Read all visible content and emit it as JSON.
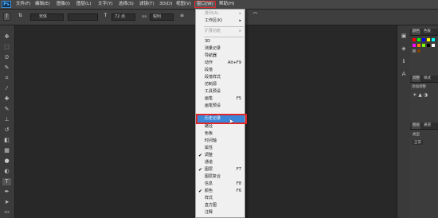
{
  "app": {
    "logo": "Ps"
  },
  "menubar": {
    "items": [
      {
        "label": "文件(F)"
      },
      {
        "label": "编辑(E)"
      },
      {
        "label": "图像(I)"
      },
      {
        "label": "图层(L)"
      },
      {
        "label": "文字(Y)"
      },
      {
        "label": "选择(S)"
      },
      {
        "label": "滤镜(T)"
      },
      {
        "label": "3D(D)"
      },
      {
        "label": "视图(V)"
      },
      {
        "label": "窗口(W)"
      },
      {
        "label": "帮助(H)"
      }
    ]
  },
  "options": {
    "font_family": "宋体",
    "font_size": "72 点",
    "antialias": "锐利"
  },
  "window_menu": {
    "items": [
      {
        "label": "排列(A)",
        "shortcut": "▸",
        "disabled": true
      },
      {
        "label": "工作区(K)",
        "shortcut": "▸"
      },
      {
        "label": "扩展功能",
        "shortcut": "▸",
        "disabled": true
      },
      {
        "label": "3D"
      },
      {
        "label": "测量记录"
      },
      {
        "label": "导航器"
      },
      {
        "label": "动作",
        "shortcut": "Alt+F9"
      },
      {
        "label": "段落"
      },
      {
        "label": "段落样式"
      },
      {
        "label": "仿制源"
      },
      {
        "label": "工具预设"
      },
      {
        "label": "画笔",
        "shortcut": "F5"
      },
      {
        "label": "画笔预设"
      },
      {
        "label": "历史记录",
        "highlighted": true
      },
      {
        "label": "路径"
      },
      {
        "label": "色板"
      },
      {
        "label": "时间轴"
      },
      {
        "label": "属性"
      },
      {
        "label": "调整",
        "checked": true
      },
      {
        "label": "通道"
      },
      {
        "label": "图层",
        "shortcut": "F7",
        "checked": true
      },
      {
        "label": "图层复合"
      },
      {
        "label": "信息",
        "shortcut": "F8"
      },
      {
        "label": "颜色",
        "shortcut": "F6",
        "checked": true
      },
      {
        "label": "样式"
      },
      {
        "label": "直方图"
      },
      {
        "label": "注释"
      }
    ]
  },
  "panels": {
    "color_tab": "颜色",
    "swatches_tab": "色板",
    "adjust_tab": "调整",
    "styles_tab": "样式",
    "add_adjust": "添加调整",
    "layers_tab": "图层",
    "channels_tab": "通道",
    "blend_mode": "正常",
    "kind": "类型"
  },
  "colors": {
    "accent_highlight": "#3a86d8",
    "annotation_red": "#e1262a",
    "swatches": [
      "#ff0000",
      "#00ff00",
      "#0000ff",
      "#ffff00",
      "#00ffff",
      "#ff00ff",
      "#ff8000",
      "#80ff00",
      "#000000",
      "#ffffff",
      "#808080",
      "#804000"
    ]
  }
}
